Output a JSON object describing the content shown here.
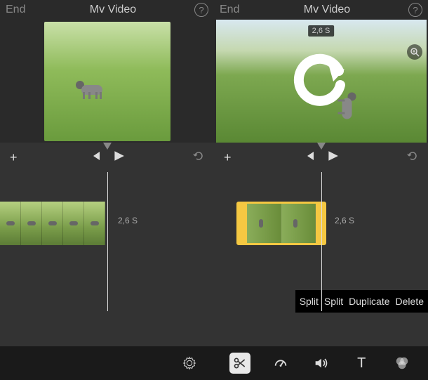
{
  "left": {
    "header": {
      "end": "End",
      "title": "Mv Video"
    },
    "clip": {
      "duration": "2,6 S"
    }
  },
  "right": {
    "header": {
      "end": "End",
      "title": "Mv Video"
    },
    "preview": {
      "timeBadge": "2,6 S"
    },
    "clip": {
      "duration": "2,6 S"
    },
    "contextMenu": {
      "split1": "Split",
      "split2": "Split",
      "duplicate": "Duplicate",
      "delete": "Delete"
    }
  },
  "icons": {
    "help": "?",
    "plus": "+",
    "text": "T"
  }
}
